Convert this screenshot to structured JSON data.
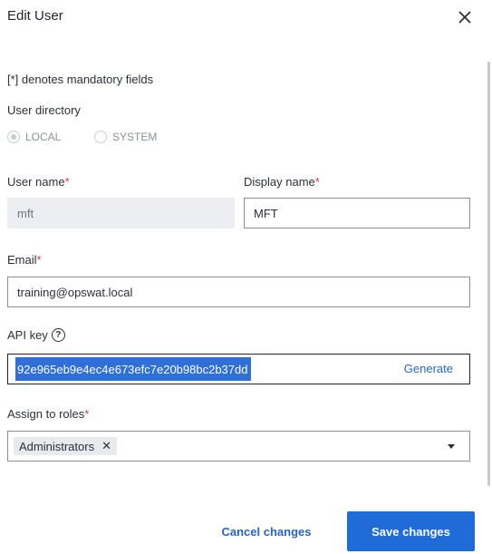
{
  "dialog": {
    "title": "Edit User",
    "close_icon": "close-icon"
  },
  "form": {
    "mandatory_note": "[*] denotes mandatory fields",
    "user_directory": {
      "label": "User directory",
      "options": [
        "LOCAL",
        "SYSTEM"
      ],
      "selected": "LOCAL"
    },
    "username": {
      "label": "User name",
      "required_mark": "*",
      "value": "mft"
    },
    "display_name": {
      "label": "Display name",
      "required_mark": "*",
      "value": "MFT"
    },
    "email": {
      "label": "Email",
      "required_mark": "*",
      "value": "training@opswat.local"
    },
    "api_key": {
      "label": "API key",
      "help_icon": "help-icon",
      "help_glyph": "?",
      "value": "92e965eb9e4ec4e673efc7e20b98bc2b37dd",
      "generate_label": "Generate"
    },
    "roles": {
      "label": "Assign to roles",
      "required_mark": "*",
      "selected": [
        "Administrators"
      ],
      "remove_glyph": "✕",
      "dropdown_icon": "chevron-down-icon"
    }
  },
  "actions": {
    "cancel_label": "Cancel changes",
    "save_label": "Save changes"
  },
  "colors": {
    "accent": "#1f6bd8",
    "required": "#d63b3b",
    "selection": "#2f6fd6"
  }
}
